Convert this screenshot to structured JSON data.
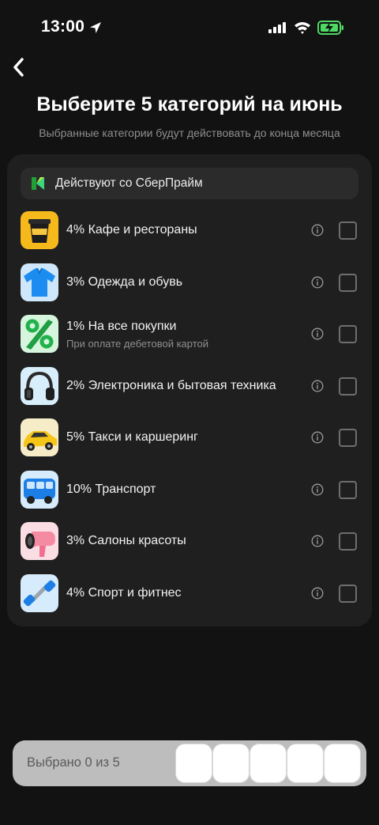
{
  "status_bar": {
    "time": "13:00"
  },
  "header": {
    "title": "Выберите 5 категорий на июнь",
    "subtitle": "Выбранные категории будут действовать до конца месяца"
  },
  "banner": {
    "text": "Действуют со СберПрайм"
  },
  "categories": [
    {
      "label": "4% Кафе и рестораны",
      "sublabel": "",
      "icon": "coffee-cup-icon"
    },
    {
      "label": "3% Одежда и обувь",
      "sublabel": "",
      "icon": "polo-shirt-icon"
    },
    {
      "label": "1% На все покупки",
      "sublabel": "При оплате дебетовой картой",
      "icon": "percent-icon"
    },
    {
      "label": "2% Электроника и бытовая техника",
      "sublabel": "",
      "icon": "headphones-icon"
    },
    {
      "label": "5% Такси и каршеринг",
      "sublabel": "",
      "icon": "car-icon"
    },
    {
      "label": "10% Транспорт",
      "sublabel": "",
      "icon": "bus-icon"
    },
    {
      "label": "3% Салоны красоты",
      "sublabel": "",
      "icon": "hair-dryer-icon"
    },
    {
      "label": "4% Спорт и фитнес",
      "sublabel": "",
      "icon": "dumbbell-icon"
    }
  ],
  "footer": {
    "selected_text": "Выбрано 0 из 5"
  },
  "colors": {
    "background": "#121212",
    "card": "#1f1f1f",
    "banner": "#2b2b2b",
    "accent_green": "#21a038",
    "battery_green": "#4cd964"
  }
}
